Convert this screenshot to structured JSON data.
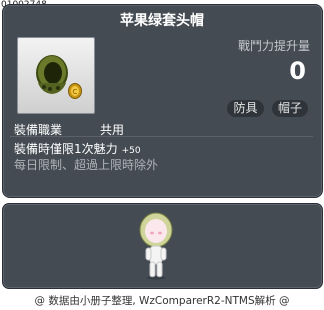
{
  "item_id": "01002748",
  "item_name": "苹果绿套头帽",
  "stat_label": "戰鬥力提升量",
  "stat_value": "0",
  "tags": [
    "防具",
    "帽子"
  ],
  "job_label": "裝備職業",
  "job_value": "共用",
  "effect_text": "裝備時僅限1次魅力",
  "effect_value": "+50",
  "limit_text": "每日限制、超過上限時除外",
  "footer_text": "@ 数据由小册子整理, WzComparerR2-NTMS解析 @",
  "icons": {
    "item": "green-hood-helmet-icon",
    "coin": "gold-coin-icon",
    "avatar": "character-preview"
  },
  "colors": {
    "panel": "#454b53",
    "title": "#ffffff",
    "limit": "#aeb3ba",
    "helmet": "#6b7a2a"
  }
}
